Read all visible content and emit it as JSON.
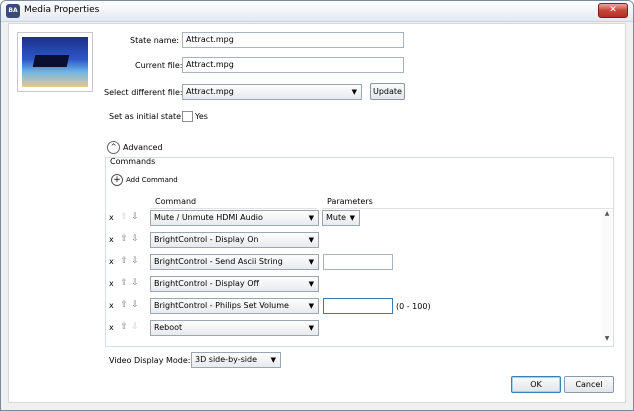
{
  "window": {
    "title": "Media Properties",
    "icon": "app-logo-icon",
    "close_glyph": "✕",
    "app_badge": "BA"
  },
  "form": {
    "state_name_label": "State name:",
    "state_name_value": "Attract.mpg",
    "current_file_label": "Current file:",
    "current_file_value": "Attract.mpg",
    "select_file_label": "Select different file:",
    "select_file_value": "Attract.mpg",
    "update_button": "Update",
    "initial_state_label": "Set as initial state:",
    "initial_state_checkbox_label": "Yes",
    "initial_state_checked": false
  },
  "advanced": {
    "label": "Advanced",
    "expander_glyph": "^",
    "commands_group_label": "Commands",
    "add_command_label": "Add Command",
    "add_glyph": "+",
    "col_command": "Command",
    "col_parameters": "Parameters"
  },
  "commands": [
    {
      "delete": "x",
      "command": "Mute / Unmute HDMI Audio",
      "param_type": "combo",
      "param_value": "Mute",
      "up_enabled": false,
      "down_enabled": true
    },
    {
      "delete": "x",
      "command": "BrightControl - Display On",
      "param_type": "none",
      "up_enabled": true,
      "down_enabled": true
    },
    {
      "delete": "x",
      "command": "BrightControl - Send Ascii String",
      "param_type": "input",
      "param_value": "",
      "up_enabled": true,
      "down_enabled": true
    },
    {
      "delete": "x",
      "command": "BrightControl - Display Off",
      "param_type": "none",
      "up_enabled": true,
      "down_enabled": true
    },
    {
      "delete": "x",
      "command": "BrightControl - Philips Set Volume",
      "param_type": "input",
      "param_value": "",
      "param_hint": "(0 - 100)",
      "up_enabled": true,
      "down_enabled": true
    },
    {
      "delete": "x",
      "command": "Reboot",
      "param_type": "none",
      "up_enabled": true,
      "down_enabled": false
    }
  ],
  "video": {
    "label": "Video Display Mode:",
    "value": "3D side-by-side"
  },
  "footer": {
    "ok": "OK",
    "cancel": "Cancel"
  },
  "glyphs": {
    "combo_arrow": "▼",
    "up": "⇧",
    "down": "⇩",
    "scroll_up": "▲",
    "scroll_down": "▼"
  }
}
